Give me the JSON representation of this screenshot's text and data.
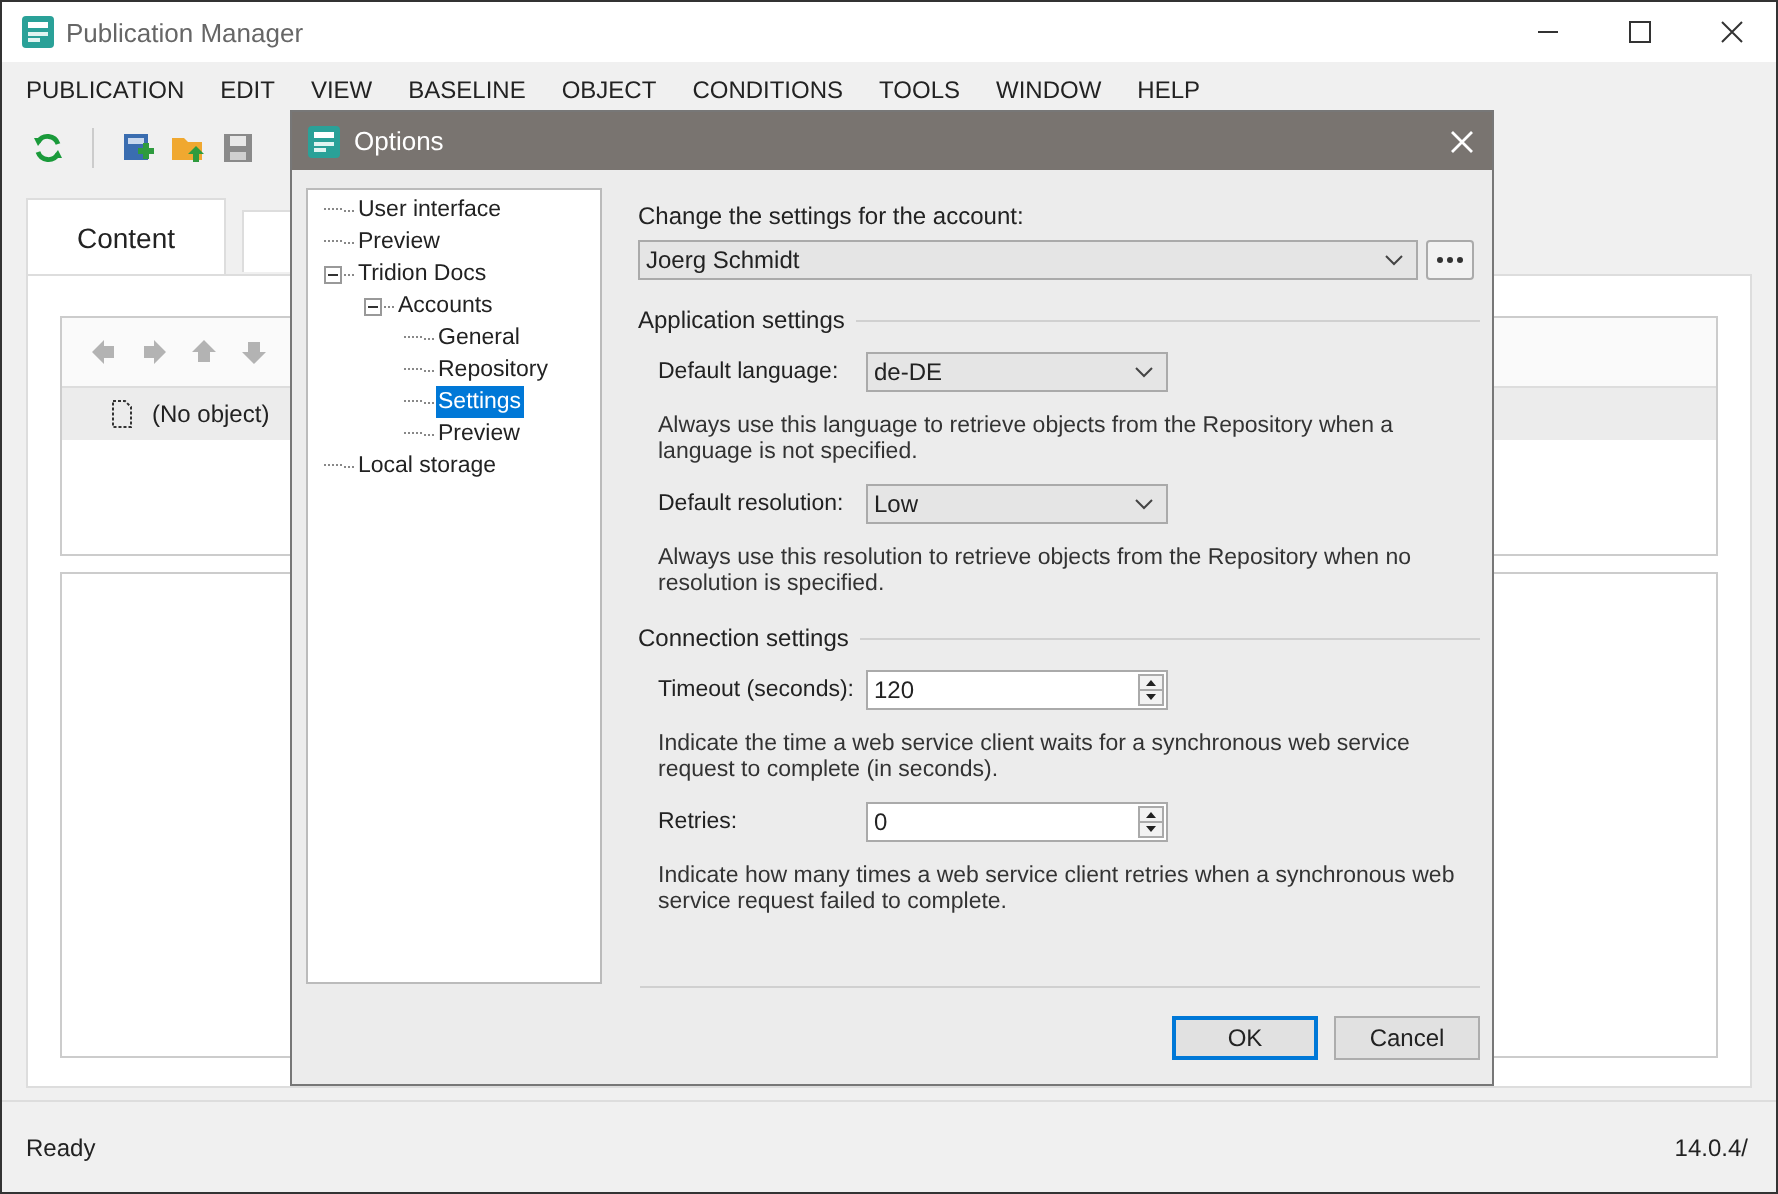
{
  "window": {
    "title": "Publication Manager"
  },
  "menu": [
    "PUBLICATION",
    "EDIT",
    "VIEW",
    "BASELINE",
    "OBJECT",
    "CONDITIONS",
    "TOOLS",
    "WINDOW",
    "HELP"
  ],
  "tabs": [
    {
      "label": "Content",
      "selected": true
    }
  ],
  "rows": [
    {
      "label": "(No object)",
      "selected": true
    }
  ],
  "status_bar": {
    "text": "Ready",
    "version": "14.0.4/"
  },
  "dialog": {
    "title": "Options",
    "tree": [
      {
        "label": "User interface",
        "selected": false
      },
      {
        "label": "Preview",
        "selected": false
      },
      {
        "label": "Tridion Docs",
        "selected": false,
        "expanded": true,
        "children": [
          {
            "label": "Accounts",
            "selected": false,
            "expanded": true,
            "children": [
              {
                "label": "General",
                "selected": false
              },
              {
                "label": "Repository",
                "selected": false
              },
              {
                "label": "Settings",
                "selected": true
              },
              {
                "label": "Preview",
                "selected": false
              }
            ]
          }
        ]
      },
      {
        "label": "Local storage",
        "selected": false
      }
    ],
    "account_label": "Change the settings for the account:",
    "account": "Joerg Schmidt",
    "sections": [
      {
        "title": "Application settings",
        "fields": [
          {
            "kind": "dropdown",
            "label": "Default language:",
            "value": "de-DE",
            "help": "Always use this language to retrieve objects from the Repository when a language is not specified."
          },
          {
            "kind": "dropdown",
            "label": "Default resolution:",
            "value": "Low",
            "help": "Always use this resolution to retrieve objects from the Repository when no resolution is specified."
          }
        ]
      },
      {
        "title": "Connection settings",
        "fields": [
          {
            "kind": "spin",
            "label": "Timeout (seconds):",
            "value": "120",
            "help": "Indicate the time a web service client waits for a synchronous web service request to complete (in seconds)."
          },
          {
            "kind": "spin",
            "label": "Retries:",
            "value": "0",
            "help": "Indicate how many times a web service client retries when a synchronous web service request failed to complete."
          }
        ]
      }
    ],
    "buttons": [
      {
        "label": "OK",
        "default": true
      },
      {
        "label": "Cancel",
        "default": false
      }
    ]
  }
}
